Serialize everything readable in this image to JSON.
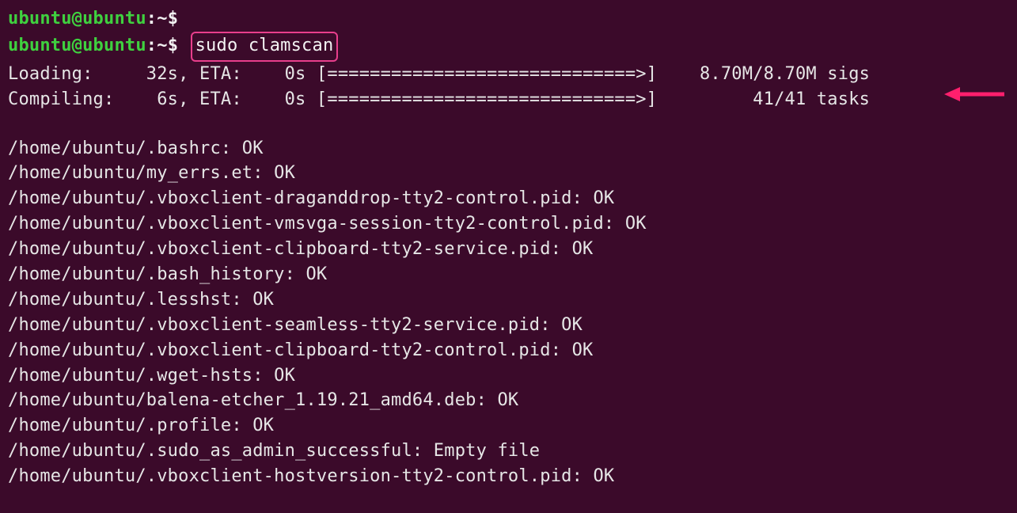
{
  "prompt": {
    "user_host": "ubuntu@ubuntu",
    "colon": ":",
    "path": "~",
    "dollar": "$",
    "command": "sudo clamscan"
  },
  "progress": {
    "loading": {
      "label": "Loading:",
      "elapsed": "32s",
      "eta_label": "ETA:",
      "eta": "0s",
      "bar": "[=============================>]",
      "status": "8.70M/8.70M sigs"
    },
    "compiling": {
      "label": "Compiling:",
      "elapsed": "6s",
      "eta_label": "ETA:",
      "eta": "0s",
      "bar": "[=============================>]",
      "status": "41/41 tasks"
    }
  },
  "scan_results": [
    "/home/ubuntu/.bashrc: OK",
    "/home/ubuntu/my_errs.et: OK",
    "/home/ubuntu/.vboxclient-draganddrop-tty2-control.pid: OK",
    "/home/ubuntu/.vboxclient-vmsvga-session-tty2-control.pid: OK",
    "/home/ubuntu/.vboxclient-clipboard-tty2-service.pid: OK",
    "/home/ubuntu/.bash_history: OK",
    "/home/ubuntu/.lesshst: OK",
    "/home/ubuntu/.vboxclient-seamless-tty2-service.pid: OK",
    "/home/ubuntu/.vboxclient-clipboard-tty2-control.pid: OK",
    "/home/ubuntu/.wget-hsts: OK",
    "/home/ubuntu/balena-etcher_1.19.21_amd64.deb: OK",
    "/home/ubuntu/.profile: OK",
    "/home/ubuntu/.sudo_as_admin_successful: Empty file",
    "/home/ubuntu/.vboxclient-hostversion-tty2-control.pid: OK"
  ],
  "colors": {
    "background": "#3b0a2a",
    "prompt_green": "#3fd13f",
    "text": "#e6e6e6",
    "highlight_box": "#e83e8c",
    "arrow": "#ff1f6d"
  }
}
